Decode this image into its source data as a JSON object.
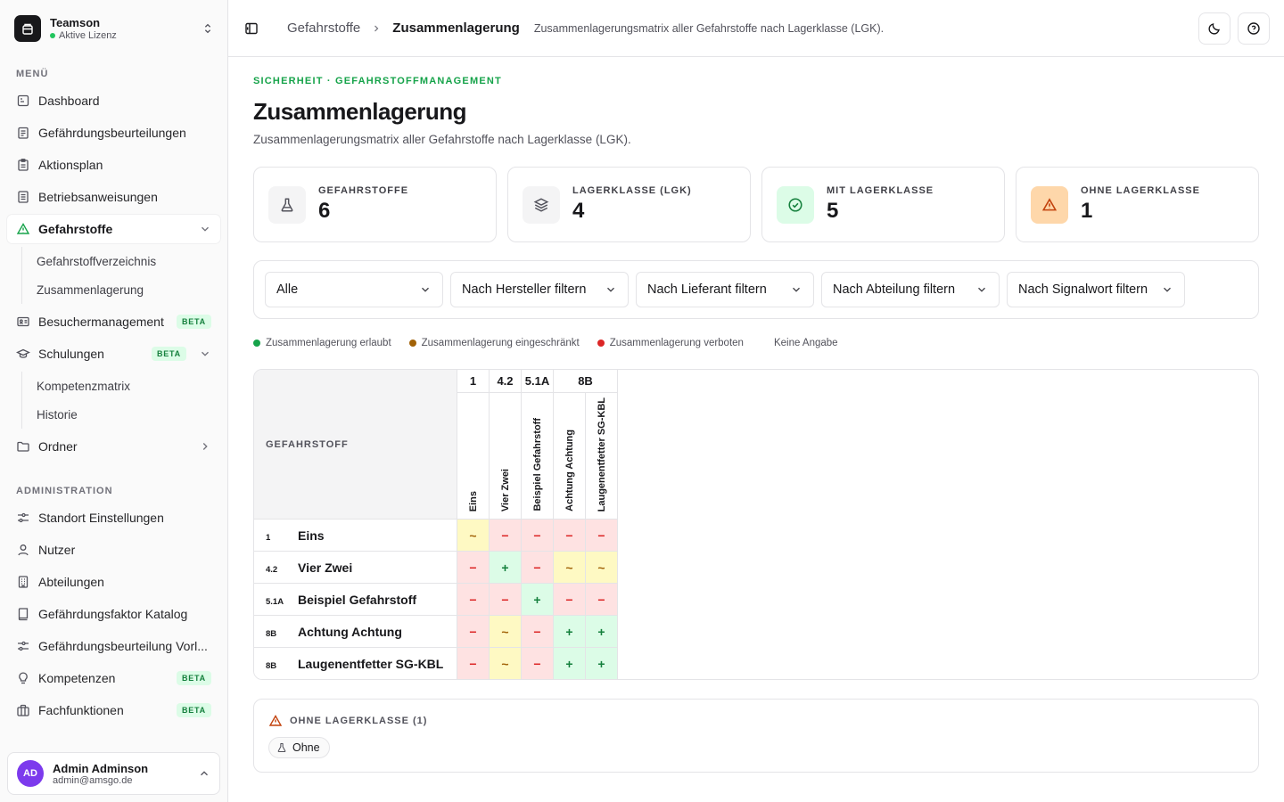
{
  "org": {
    "name": "Teamson",
    "license": "Aktive Lizenz"
  },
  "sidebar": {
    "menu_label": "MENÜ",
    "admin_label": "ADMINISTRATION",
    "menu": [
      {
        "label": "Dashboard"
      },
      {
        "label": "Gefährdungsbeurteilungen"
      },
      {
        "label": "Aktionsplan"
      },
      {
        "label": "Betriebsanweisungen"
      },
      {
        "label": "Gefahrstoffe"
      },
      {
        "label": "Gefahrstoffverzeichnis"
      },
      {
        "label": "Zusammenlagerung"
      },
      {
        "label": "Besuchermanagement",
        "badge": "BETA"
      },
      {
        "label": "Schulungen",
        "badge": "BETA"
      },
      {
        "label": "Kompetenzmatrix"
      },
      {
        "label": "Historie"
      },
      {
        "label": "Ordner"
      }
    ],
    "admin": [
      {
        "label": "Standort Einstellungen"
      },
      {
        "label": "Nutzer"
      },
      {
        "label": "Abteilungen"
      },
      {
        "label": "Gefährdungsfaktor Katalog"
      },
      {
        "label": "Gefährdungsbeurteilung Vorl..."
      },
      {
        "label": "Kompetenzen",
        "badge": "BETA"
      },
      {
        "label": "Fachfunktionen",
        "badge": "BETA"
      }
    ]
  },
  "user": {
    "initials": "AD",
    "name": "Admin Adminson",
    "email": "admin@amsgo.de"
  },
  "header": {
    "crumb_parent": "Gefahrstoffe",
    "crumb_current": "Zusammenlagerung",
    "description": "Zusammenlagerungsmatrix aller Gefahrstoffe nach Lagerklasse (LGK)."
  },
  "page": {
    "eyebrow": "SICHERHEIT · GEFAHRSTOFFMANAGEMENT",
    "title": "Zusammenlagerung",
    "lead": "Zusammenlagerungsmatrix aller Gefahrstoffe nach Lagerklasse (LGK)."
  },
  "stats": [
    {
      "label": "GEFAHRSTOFFE",
      "value": "6",
      "icon": "flask-icon"
    },
    {
      "label": "LAGERKLASSE (LGK)",
      "value": "4",
      "icon": "layers-icon"
    },
    {
      "label": "MIT LAGERKLASSE",
      "value": "5",
      "icon": "check-circle-icon"
    },
    {
      "label": "OHNE LAGERKLASSE",
      "value": "1",
      "icon": "warning-icon"
    }
  ],
  "filters": [
    {
      "value": "Alle"
    },
    {
      "value": "Nach Hersteller filtern"
    },
    {
      "value": "Nach Lieferant filtern"
    },
    {
      "value": "Nach Abteilung filtern"
    },
    {
      "value": "Nach Signalwort filtern"
    }
  ],
  "legend": [
    {
      "label": "Zusammenlagerung erlaubt",
      "color": "#16a34a"
    },
    {
      "label": "Zusammenlagerung eingeschränkt",
      "color": "#a16207"
    },
    {
      "label": "Zusammenlagerung verboten",
      "color": "#dc2626"
    },
    {
      "label": "Keine Angabe",
      "color": ""
    }
  ],
  "matrix": {
    "header_label": "GEFAHRSTOFF",
    "class_groups": [
      "1",
      "4.2",
      "5.1A",
      "8B"
    ],
    "columns": [
      "Eins",
      "Vier Zwei",
      "Beispiel Gefahrstoff",
      "Achtung Achtung",
      "Laugenentfetter SG-KBL"
    ],
    "rows": [
      {
        "cls": "1",
        "name": "Eins",
        "cells": [
          "~",
          "−",
          "−",
          "−",
          "−"
        ]
      },
      {
        "cls": "4.2",
        "name": "Vier Zwei",
        "cells": [
          "−",
          "+",
          "−",
          "~",
          "~"
        ]
      },
      {
        "cls": "5.1A",
        "name": "Beispiel Gefahrstoff",
        "cells": [
          "−",
          "−",
          "+",
          "−",
          "−"
        ]
      },
      {
        "cls": "8B",
        "name": "Achtung Achtung",
        "cells": [
          "−",
          "~",
          "−",
          "+",
          "+"
        ]
      },
      {
        "cls": "8B",
        "name": "Laugenentfetter SG-KBL",
        "cells": [
          "−",
          "~",
          "−",
          "+",
          "+"
        ]
      }
    ]
  },
  "ohne": {
    "title": "OHNE LAGERKLASSE (1)",
    "items": [
      "Ohne"
    ]
  }
}
